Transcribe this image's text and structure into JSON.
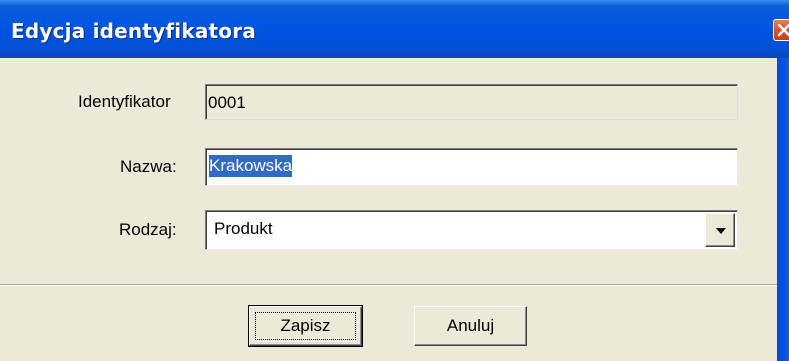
{
  "window": {
    "title": "Edycja identyfikatora"
  },
  "form": {
    "identifier": {
      "label": "Identyfikator",
      "value": "0001"
    },
    "name": {
      "label": "Nazwa:",
      "value": "Krakowska"
    },
    "type": {
      "label": "Rodzaj:",
      "value": "Produkt"
    }
  },
  "buttons": {
    "save_label": "Zapisz",
    "cancel_label": "Anuluj"
  },
  "icons": {
    "close": "close-icon",
    "dropdown": "chevron-down-icon"
  },
  "colors": {
    "titlebar": "#0054e3",
    "close_button": "#d8532e",
    "selection": "#316ac5",
    "dialog_background": "#ece9d8"
  }
}
